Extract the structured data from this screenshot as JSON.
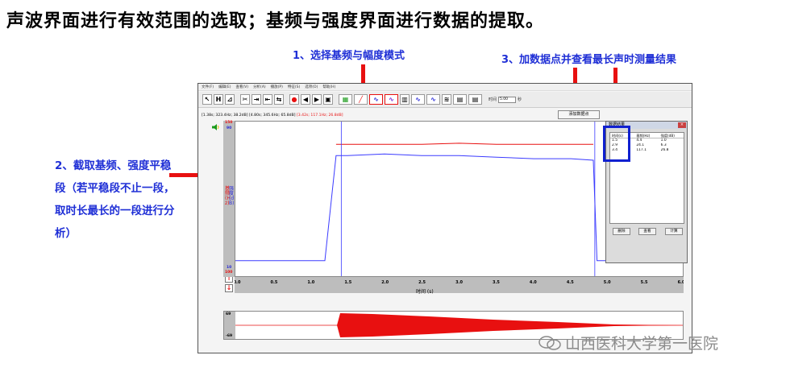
{
  "slide": {
    "title": "声波界面进行有效范围的选取；基频与强度界面进行数据的提取。"
  },
  "callouts": {
    "step1": "1、选择基频与幅度模式",
    "step2": "2、截取基频、强度平稳段（若平稳段不止一段，取时长最长的一段进行分析）",
    "step3": "3、加数据点并查看最长声时测量结果"
  },
  "app": {
    "menu": [
      "文件(F)",
      "编辑(E)",
      "查看(V)",
      "分析(A)",
      "播放(P)",
      "特征(S)",
      "选项(O)",
      "帮助(H)"
    ],
    "toolbar_buttons": [
      "↖",
      "H",
      "⊿",
      "✂",
      "⇥",
      "⇤",
      "⇆",
      "●",
      "◀",
      "▶",
      "▣",
      "▦",
      "╱",
      "∿",
      "∿",
      "▥",
      "∿",
      "∿",
      "≋",
      "▤",
      "▤"
    ],
    "toolbar_time_label": "时间",
    "toolbar_time_value": "5.00",
    "toolbar_time_unit": "秒",
    "readout_black": "[1.38s; 323.4Hz; 38.2dB] [4.80s; 345.6Hz; 65.8dB]",
    "readout_red": "[3.42s; 117.1Hz; 26.8dB]",
    "add_point_button": "添加数据点",
    "y_axis_top_red": "150",
    "y_axis_top_blue": "90",
    "y_axis_bottom_blue": "10",
    "y_axis_bottom_red": "100",
    "y_label_red": "基频 (Hz)",
    "y_label_blue": "强度 (dB)",
    "x_axis_title": "时间 (s)",
    "x_ticks": [
      "0.0",
      "0.5",
      "1.0",
      "1.5",
      "2.0",
      "2.5",
      "3.0",
      "3.5",
      "4.0",
      "4.5",
      "5.0",
      "5.5",
      "6.0"
    ],
    "waveform_top": "69",
    "waveform_bottom": "-69",
    "dialog": {
      "title": "数据结果",
      "close": "×",
      "columns": [
        "时间(s)",
        "基频(Hz)",
        "强度(dB)"
      ],
      "rows": [
        [
          "1.5",
          "4.4",
          "1.0"
        ],
        [
          "2.9",
          "24.1",
          "6.3"
        ],
        [
          "3.4",
          "117.1",
          "26.8"
        ]
      ],
      "buttons": [
        "删除",
        "查看",
        "计算"
      ]
    }
  },
  "watermark": "山西医科大学第一医院",
  "chart_data": {
    "type": "line",
    "title": "",
    "xlabel": "时间 (s)",
    "ylabel": "强度 (dB) / 基频 (Hz)",
    "xlim": [
      0.0,
      6.0
    ],
    "series": [
      {
        "name": "强度 (dB)",
        "color": "#3b3bff",
        "x": [
          0.0,
          1.2,
          1.35,
          1.5,
          2.0,
          2.5,
          3.0,
          3.5,
          4.0,
          4.5,
          4.8,
          4.85,
          5.5,
          6.0
        ],
        "y": [
          10,
          10,
          78,
          78,
          79,
          78,
          78,
          77,
          76,
          76,
          75,
          10,
          10,
          10
        ]
      },
      {
        "name": "基频 (Hz)",
        "color": "#e81010",
        "x": [
          1.35,
          1.5,
          2.0,
          2.5,
          3.0,
          3.5,
          4.0,
          4.5,
          4.8
        ],
        "y": [
          128,
          128,
          128,
          128,
          129,
          128,
          128,
          128,
          128
        ]
      }
    ],
    "markers_x": [
      1.42,
      4.82
    ]
  }
}
